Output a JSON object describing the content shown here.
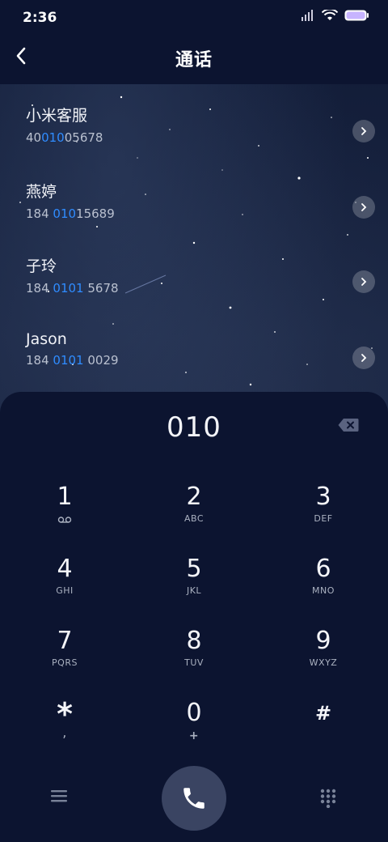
{
  "status": {
    "time": "2:36"
  },
  "header": {
    "title": "通话"
  },
  "contacts": [
    {
      "name": "小米客服",
      "num_pre": "40",
      "num_hl": "010",
      "num_post": "05678"
    },
    {
      "name": "燕婷",
      "num_pre": "184 ",
      "num_hl": "010",
      "num_post": "15689"
    },
    {
      "name": "子玲",
      "num_pre": "184 ",
      "num_hl": "0101",
      "num_post": " 5678"
    },
    {
      "name": "Jason",
      "num_pre": "184 ",
      "num_hl": "0101",
      "num_post": " 0029"
    }
  ],
  "dialer": {
    "entered": "010",
    "keys": [
      {
        "digit": "1",
        "letters": ""
      },
      {
        "digit": "2",
        "letters": "ABC"
      },
      {
        "digit": "3",
        "letters": "DEF"
      },
      {
        "digit": "4",
        "letters": "GHI"
      },
      {
        "digit": "5",
        "letters": "JKL"
      },
      {
        "digit": "6",
        "letters": "MNO"
      },
      {
        "digit": "7",
        "letters": "PQRS"
      },
      {
        "digit": "8",
        "letters": "TUV"
      },
      {
        "digit": "9",
        "letters": "WXYZ"
      },
      {
        "digit": "*",
        "letters": ","
      },
      {
        "digit": "0",
        "letters": "+"
      },
      {
        "digit": "#",
        "letters": ""
      }
    ]
  },
  "icons": {
    "back": "chevron-left-icon",
    "arrow": "chevron-right-icon",
    "backspace": "backspace-icon",
    "voicemail": "voicemail-icon",
    "menu": "menu-icon",
    "call": "phone-icon",
    "keypad": "keypad-icon"
  },
  "colors": {
    "highlight": "#2f8cff",
    "panel": "#0c1430"
  }
}
